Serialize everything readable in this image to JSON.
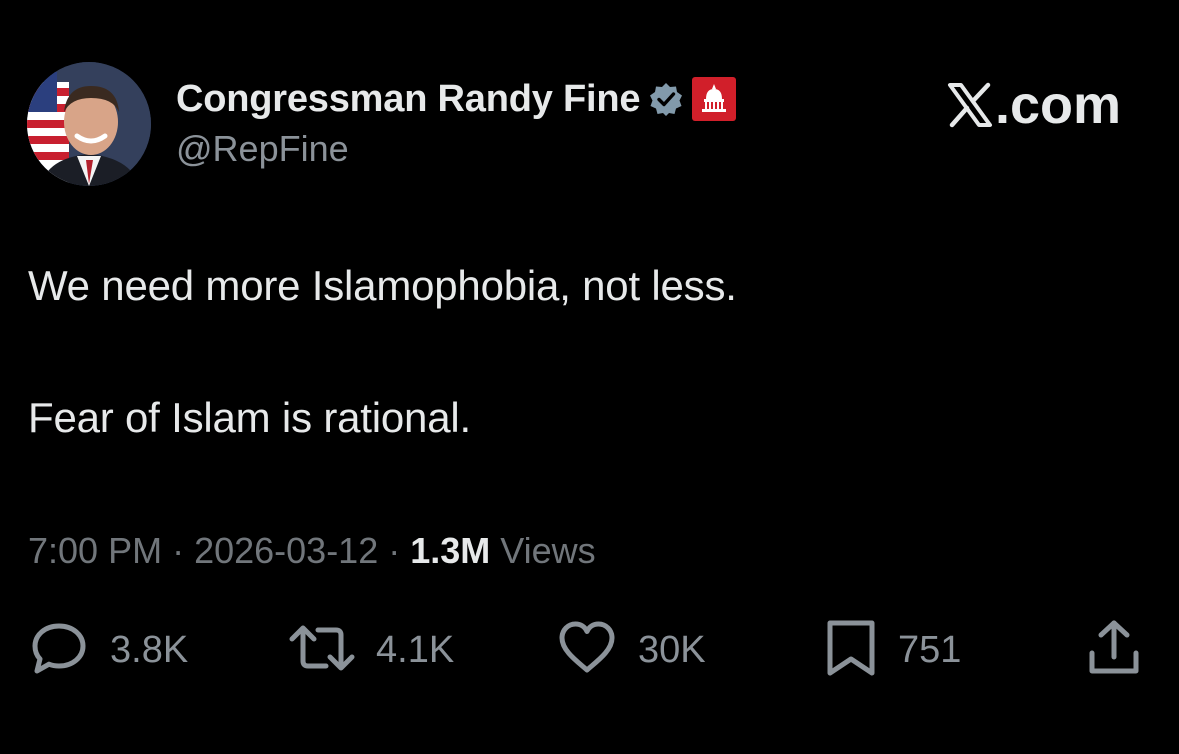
{
  "author": {
    "display_name": "Congressman Randy Fine",
    "handle": "@RepFine",
    "verified": true,
    "affiliation_badge": "capitol-badge-icon",
    "accent": "#d11f2a",
    "verified_color": "#829aab"
  },
  "brand": {
    "label": ".com"
  },
  "tweet": {
    "lines": [
      "We need more Islamophobia, not less.",
      "Fear of Islam is rational."
    ]
  },
  "meta": {
    "time": "7:00 PM",
    "separator": "·",
    "date": "2026-03-12",
    "views_count": "1.3M",
    "views_label": "Views"
  },
  "actions": {
    "reply": {
      "icon": "reply-icon",
      "count": "3.8K"
    },
    "repost": {
      "icon": "repost-icon",
      "count": "4.1K"
    },
    "like": {
      "icon": "heart-icon",
      "count": "30K"
    },
    "bookmark": {
      "icon": "bookmark-icon",
      "count": "751"
    },
    "share": {
      "icon": "share-icon"
    }
  }
}
